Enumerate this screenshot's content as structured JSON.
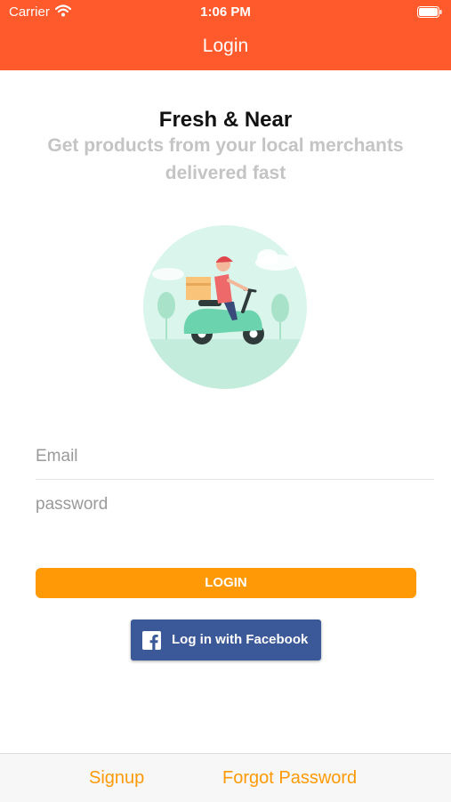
{
  "status_bar": {
    "carrier": "Carrier",
    "time": "1:06 PM"
  },
  "header": {
    "title": "Login"
  },
  "intro": {
    "title": "Fresh & Near",
    "subtitle": "Get products from your local merchants delivered fast"
  },
  "form": {
    "email_placeholder": "Email",
    "password_placeholder": "password",
    "login_label": "LOGIN",
    "facebook_label": "Log in with Facebook"
  },
  "footer": {
    "signup_label": "Signup",
    "forgot_label": "Forgot Password"
  },
  "colors": {
    "header": "#ff5a2b",
    "accent": "#ff9a06",
    "facebook": "#3b5998",
    "subtitle": "#c4c4c4"
  },
  "icons": [
    "wifi-icon",
    "battery-icon",
    "delivery-scooter-illustration",
    "facebook-icon"
  ]
}
